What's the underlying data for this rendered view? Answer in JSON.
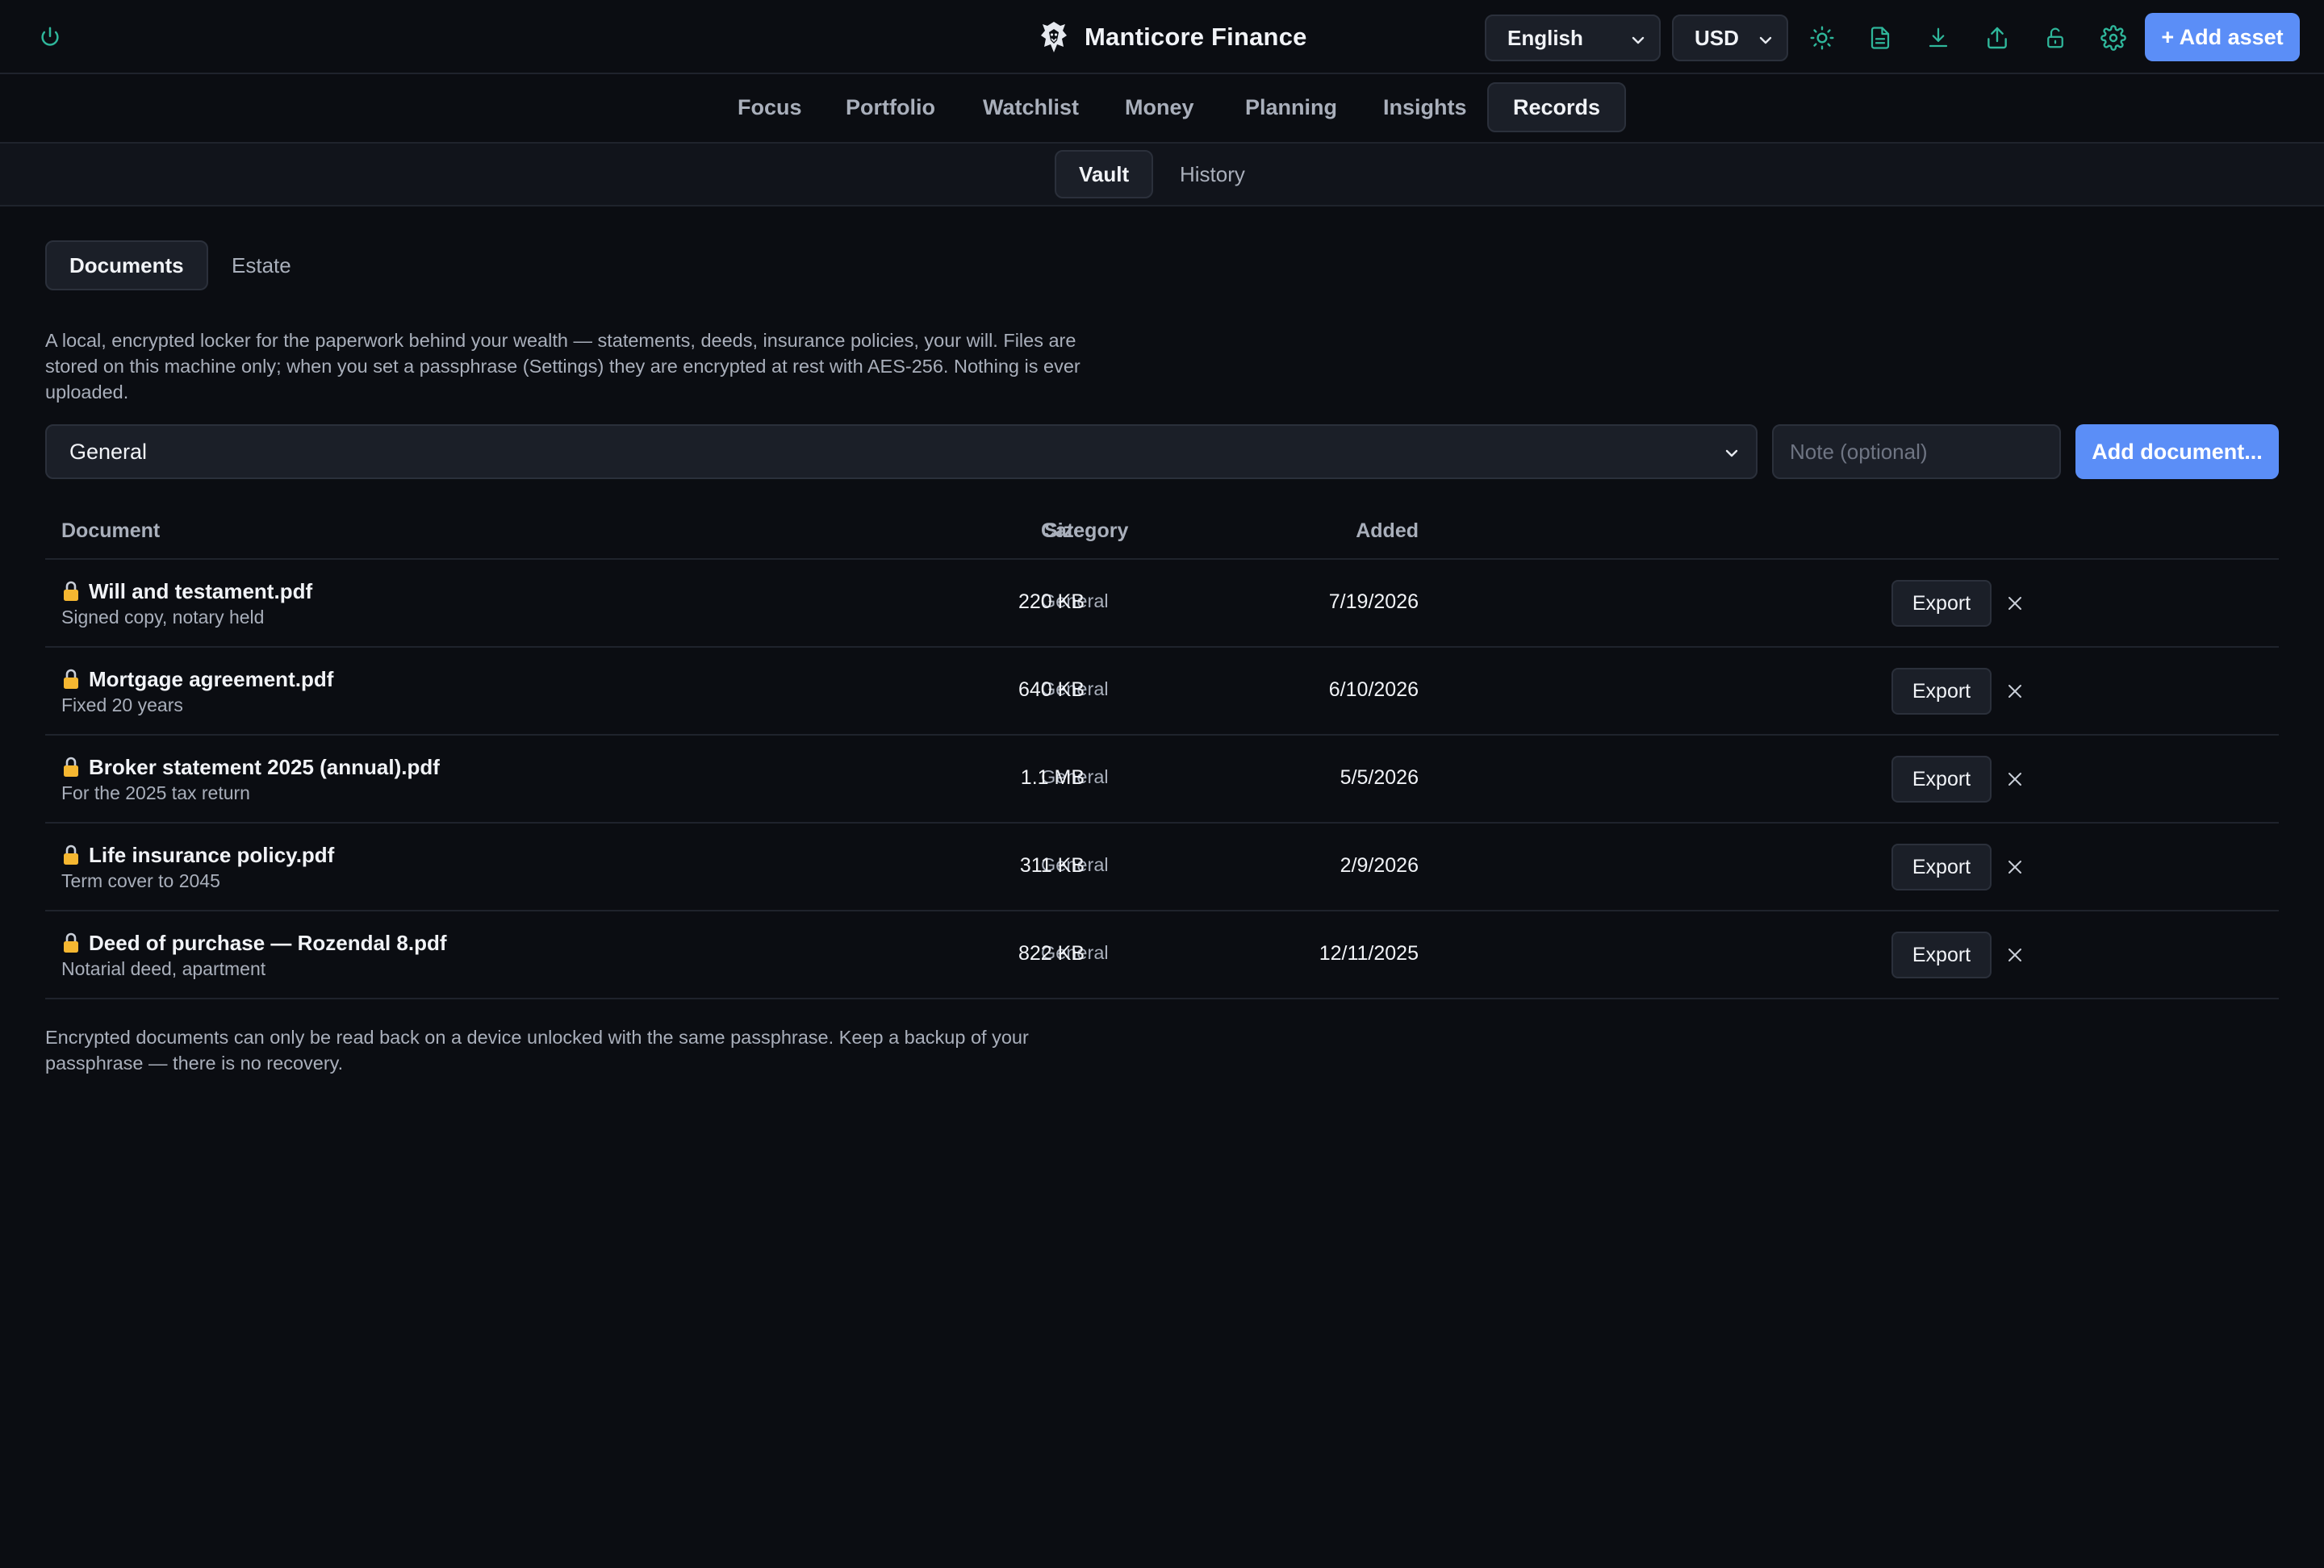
{
  "header": {
    "app_name": "Manticore Finance",
    "language": "English",
    "currency": "USD",
    "add_asset_label": "+ Add asset",
    "icons": [
      "power-icon",
      "sun-icon",
      "file-icon",
      "download-icon",
      "upload-icon",
      "unlock-icon",
      "gear-icon"
    ]
  },
  "nav": {
    "items": [
      "Focus",
      "Portfolio",
      "Watchlist",
      "Money",
      "Planning",
      "Insights",
      "Records"
    ],
    "active": "Records"
  },
  "subnav": {
    "items": [
      "Vault",
      "History"
    ],
    "active": "Vault"
  },
  "tabs": {
    "items": [
      "Documents",
      "Estate"
    ],
    "active": "Documents"
  },
  "intro": "A local, encrypted locker for the paperwork behind your wealth — statements, deeds, insurance policies, your will. Files are stored on this machine only; when you set a passphrase (Settings) they are encrypted at rest with AES-256. Nothing is ever uploaded.",
  "form": {
    "category_value": "General",
    "note_placeholder": "Note (optional)",
    "note_value": "",
    "add_label": "Add document..."
  },
  "table": {
    "headers": {
      "document": "Document",
      "category": "Category",
      "size": "Size",
      "added": "Added"
    },
    "export_label": "Export",
    "rows": [
      {
        "name": "Will and testament.pdf",
        "note": "Signed copy, notary held",
        "category": "General",
        "size": "220 KB",
        "added": "7/19/2026"
      },
      {
        "name": "Mortgage agreement.pdf",
        "note": "Fixed 20 years",
        "category": "General",
        "size": "640 KB",
        "added": "6/10/2026"
      },
      {
        "name": "Broker statement 2025 (annual).pdf",
        "note": "For the 2025 tax return",
        "category": "General",
        "size": "1.1 MB",
        "added": "5/5/2026"
      },
      {
        "name": "Life insurance policy.pdf",
        "note": "Term cover to 2045",
        "category": "General",
        "size": "311 KB",
        "added": "2/9/2026"
      },
      {
        "name": "Deed of purchase — Rozendal 8.pdf",
        "note": "Notarial deed, apartment",
        "category": "General",
        "size": "822 KB",
        "added": "12/11/2025"
      }
    ]
  },
  "footer_note": "Encrypted documents can only be read back on a device unlocked with the same passphrase. Keep a backup of your passphrase — there is no recovery.",
  "colors": {
    "background": "#0b0d12",
    "accent_blue": "#5b8ef7",
    "icon_teal": "#2fb79b",
    "lock_amber": "#f5b731"
  }
}
